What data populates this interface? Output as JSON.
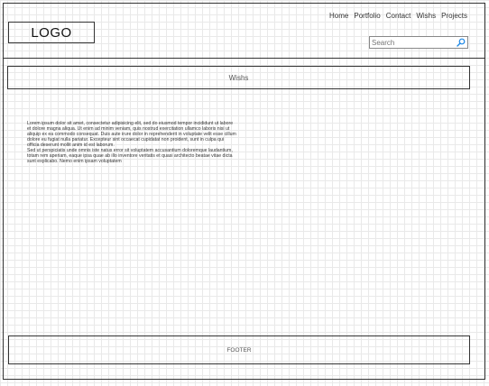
{
  "header": {
    "logo": "LOGO",
    "nav": [
      "Home",
      "Portfolio",
      "Contact",
      "Wishs",
      "Projects"
    ],
    "search_placeholder": "Search"
  },
  "banner": {
    "label": "Wishs"
  },
  "content": {
    "paragraph1": "Lorem ipsum dolor sit amet, consectetur adipisicing elit, sed do eiusmod tempor incididunt ut labore et dolore magna aliqua. Ut enim ad minim veniam, quis nostrud exercitation ullamco laboris nisi ut aliquip ex ea commodo consequat. Duis aute irure dolor in reprehenderit in voluptate velit esse cillum dolore eu fugiat nulla pariatur. Excepteur sint occaecat cupidatat non proident, sunt in culpa qui officia deserunt mollit anim id est laborum.",
    "paragraph2": "Sed ut perspiciatis unde omnis iste natus error sit voluptatem accusantium doloremque laudantium, totam rem aperiam, eaque ipsa quae ab illo inventore veritatis et quasi architecto beatae vitae dicta sunt explicabo. Nemo enim ipsam voluptatem"
  },
  "footer": {
    "label": "FOOTER"
  },
  "colors": {
    "line": "#333333",
    "grid": "#e9e9e9",
    "search_icon": "#1e88e5"
  },
  "icons": {
    "search": "search-icon"
  }
}
